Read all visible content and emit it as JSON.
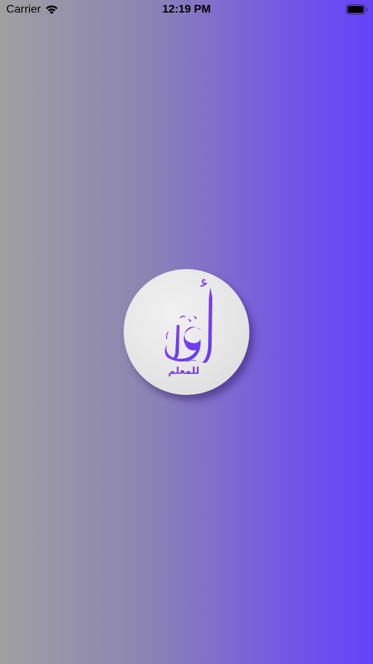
{
  "status_bar": {
    "carrier": "Carrier",
    "time": "12:19 PM",
    "wifi_icon": "wifi-icon",
    "battery_icon": "battery-icon"
  },
  "splash": {
    "logo_icon": "iqra-calligraphy-logo",
    "logo_text": "اقرأ للمعلم",
    "colors": {
      "gradient_start": "#a09fa2",
      "gradient_end": "#6543fb",
      "logo_ink": "#7a3bf0"
    }
  }
}
